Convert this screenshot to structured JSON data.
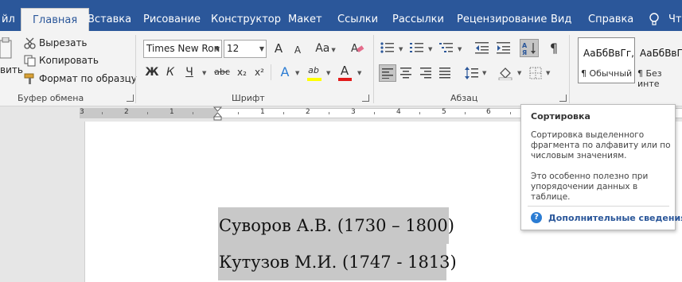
{
  "tabs": [
    "йл",
    "Главная",
    "Вставка",
    "Рисование",
    "Конструктор",
    "Макет",
    "Ссылки",
    "Рассылки",
    "Рецензирование",
    "Вид",
    "Справка",
    "Что"
  ],
  "active_tab": "Главная",
  "clipboard": {
    "paste_label": "вить",
    "cut_label": "Вырезать",
    "copy_label": "Копировать",
    "format_painter_label": "Формат по образцу",
    "group_label": "Буфер обмена"
  },
  "font": {
    "font_name": "Times New Ron",
    "font_size": "12",
    "group_label": "Шрифт",
    "bold": "Ж",
    "italic": "К",
    "underline": "Ч",
    "strike": "abc",
    "subscript": "x₂",
    "superscript": "x²",
    "grow": "A",
    "shrink": "A",
    "case": "Aa",
    "text_effects": "A",
    "highlight_letters": "ab",
    "font_color_letter": "A",
    "highlight_color": "#ffff00",
    "font_color": "#e21b1b"
  },
  "paragraph": {
    "group_label": "Абзац"
  },
  "styles": {
    "items": [
      {
        "preview": "АаБбВвГг,",
        "name": "¶ Обычный"
      },
      {
        "preview": "АаБбВвГ",
        "name": "¶ Без инте"
      }
    ]
  },
  "ruler": {
    "numbers": [
      "3",
      "2",
      "1",
      "1",
      "2",
      "3",
      "4",
      "5",
      "6"
    ]
  },
  "document": {
    "lines": [
      "Суворов А.В. (1730 – 1800)",
      "Кутузов М.И. (1747 - 1813)"
    ]
  },
  "tooltip": {
    "title": "Сортировка",
    "body_line1": "Сортировка выделенного фрагмента по алфавиту или по числовым значениям.",
    "body_line2": "Это особенно полезно при упорядочении данных в таблице.",
    "help_link": "Дополнительные сведения",
    "help_icon": "?"
  },
  "colors": {
    "tabbar": "#2b579a",
    "ribbon": "#f3f3f3",
    "selection": "#c8c8c8"
  }
}
